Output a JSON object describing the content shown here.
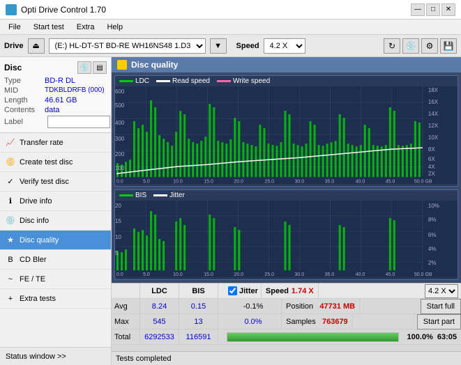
{
  "app": {
    "title": "Opti Drive Control 1.70",
    "icon": "disc-icon"
  },
  "title_controls": {
    "minimize": "—",
    "maximize": "□",
    "close": "✕"
  },
  "menu": {
    "items": [
      "File",
      "Start test",
      "Extra",
      "Help"
    ]
  },
  "drive_bar": {
    "label": "Drive",
    "drive_value": "(E:)  HL-DT-ST BD-RE  WH16NS48 1.D3",
    "speed_label": "Speed",
    "speed_value": "4.2 X"
  },
  "disc_panel": {
    "label": "Disc",
    "rows": [
      {
        "label": "Type",
        "value": "BD-R DL"
      },
      {
        "label": "MID",
        "value": "TDKBLDRFB (000)"
      },
      {
        "label": "Length",
        "value": "46.61 GB"
      },
      {
        "label": "Contents",
        "value": "data"
      },
      {
        "label": "Label",
        "value": ""
      }
    ]
  },
  "sidebar": {
    "items": [
      {
        "id": "transfer-rate",
        "label": "Transfer rate",
        "icon": "↗"
      },
      {
        "id": "create-test-disc",
        "label": "Create test disc",
        "icon": "+"
      },
      {
        "id": "verify-test-disc",
        "label": "Verify test disc",
        "icon": "✓"
      },
      {
        "id": "drive-info",
        "label": "Drive info",
        "icon": "i"
      },
      {
        "id": "disc-info",
        "label": "Disc info",
        "icon": "💿"
      },
      {
        "id": "disc-quality",
        "label": "Disc quality",
        "icon": "★",
        "active": true
      },
      {
        "id": "cd-bler",
        "label": "CD Bler",
        "icon": "B"
      },
      {
        "id": "fe-te",
        "label": "FE / TE",
        "icon": "~"
      },
      {
        "id": "extra-tests",
        "label": "Extra tests",
        "icon": "+"
      }
    ],
    "status_window": "Status window >>",
    "status_window_icon": "▼"
  },
  "chart": {
    "title": "Disc quality",
    "title_icon": "⚙",
    "top_legend": [
      {
        "label": "LDC",
        "color": "#00cc00"
      },
      {
        "label": "Read speed",
        "color": "#ffffff"
      },
      {
        "label": "Write speed",
        "color": "#ff66aa"
      }
    ],
    "top_y_axis_right": [
      "18X",
      "16X",
      "14X",
      "12X",
      "10X",
      "8X",
      "6X",
      "4X",
      "2X"
    ],
    "top_y_axis_left": [
      "600",
      "500",
      "400",
      "300",
      "200",
      "100"
    ],
    "x_axis": [
      "0.0",
      "5.0",
      "10.0",
      "15.0",
      "20.0",
      "25.0",
      "30.0",
      "35.0",
      "40.0",
      "45.0",
      "50.0 GB"
    ],
    "bottom_legend": [
      {
        "label": "BIS",
        "color": "#00cc00"
      },
      {
        "label": "Jitter",
        "color": "#ffffff"
      }
    ],
    "bottom_y_axis_right": [
      "10%",
      "8%",
      "6%",
      "4%",
      "2%"
    ],
    "bottom_y_axis_left": [
      "20",
      "15",
      "10",
      "5"
    ]
  },
  "stats": {
    "headers": [
      "",
      "LDC",
      "BIS",
      "",
      "Jitter",
      "Speed",
      "",
      ""
    ],
    "avg_label": "Avg",
    "avg_ldc": "8.24",
    "avg_bis": "0.15",
    "avg_jitter": "-0.1%",
    "max_label": "Max",
    "max_ldc": "545",
    "max_bis": "13",
    "max_jitter": "0.0%",
    "total_label": "Total",
    "total_ldc": "6292533",
    "total_bis": "116591",
    "speed_value": "1.74 X",
    "speed_dropdown": "4.2 X",
    "position_label": "Position",
    "position_value": "47731 MB",
    "samples_label": "Samples",
    "samples_value": "763679",
    "jitter_checked": true,
    "jitter_label": "Jitter",
    "start_full": "Start full",
    "start_part": "Start part",
    "progress_percent": "100.0%",
    "time": "63:05"
  },
  "status": {
    "text": "Tests completed",
    "progress": 100
  }
}
